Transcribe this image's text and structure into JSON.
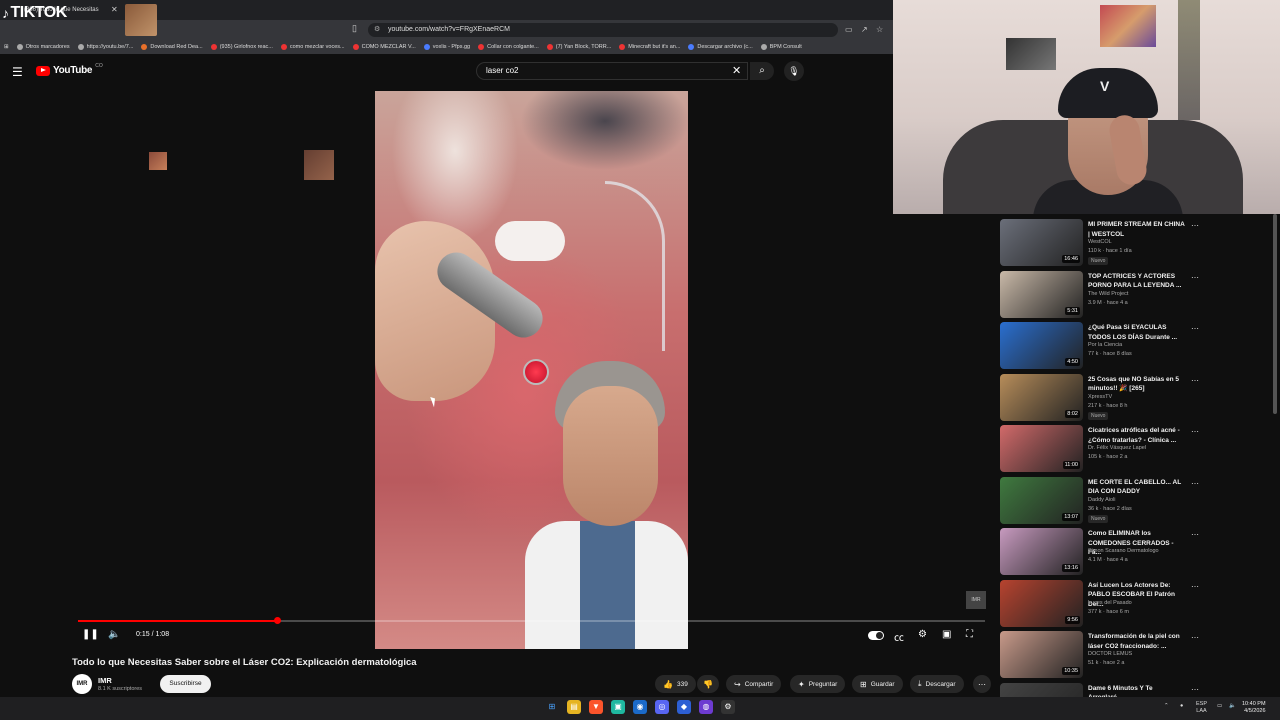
{
  "browser": {
    "tab_title": "(336) Todo lo que Necesitas",
    "url": "youtube.com/watch?v=FRgXEnaeRCM",
    "bookmarks": [
      {
        "label": "Otros marcadores",
        "color": "gray"
      },
      {
        "label": "https://youtu.be/7...",
        "color": "gray"
      },
      {
        "label": "Download Red Dea...",
        "color": "orange"
      },
      {
        "label": "(935) Girlofnox reac...",
        "color": "red"
      },
      {
        "label": "como mezclar voces...",
        "color": "red"
      },
      {
        "label": "COMO MEZCLAR V...",
        "color": "red"
      },
      {
        "label": "voxlis - Pfps.gg",
        "color": "blue"
      },
      {
        "label": "Collar con colgante...",
        "color": "red"
      },
      {
        "label": "(7) Yan Block, TORR...",
        "color": "red"
      },
      {
        "label": "Minecraft but it's an...",
        "color": "red"
      },
      {
        "label": "Descargar archivo (c...",
        "color": "blue"
      },
      {
        "label": "BPM Consult",
        "color": "gray"
      }
    ]
  },
  "overlay": {
    "tiktok_label": "TIKTOK"
  },
  "youtube": {
    "logo_text": "YouTube",
    "logo_region": "CO",
    "search_query": "laser co2"
  },
  "player": {
    "time_current": "0:15",
    "time_total": "1:08",
    "time_display": "0:15 / 1:08",
    "progress_fraction": 0.22,
    "channel_badge": "IMR"
  },
  "video": {
    "title": "Todo lo que Necesitas Saber sobre el Láser CO2: Explicación dermatológica",
    "channel_avatar": "IMR",
    "channel_name": "IMR",
    "subscribers": "8.1 K suscriptores",
    "subscribe_label": "Suscribirse",
    "likes": "339",
    "share_label": "Compartir",
    "ask_label": "Preguntar",
    "save_label": "Guardar",
    "download_label": "Descargar"
  },
  "recommendations": [
    {
      "title": "MI PRIMER STREAM EN CHINA | WESTCOL",
      "channel": "WestCOL",
      "meta": "110 k · hace 1 día",
      "duration": "16:46",
      "badge": "Nuevo",
      "thumb_color": "#6b6f7a"
    },
    {
      "title": "TOP ACTRICES Y ACTORES PORNO PARA LA LEYENDA ...",
      "channel": "The Wild Project",
      "meta": "3.9 M · hace 4 a",
      "duration": "5:31",
      "badge": "",
      "thumb_color": "#c9b9a8"
    },
    {
      "title": "¿Qué Pasa Si EYACULAS TODOS LOS DÍAS Durante ...",
      "channel": "Por la Ciencia",
      "meta": "77 k · hace 8 días",
      "duration": "4:50",
      "badge": "",
      "thumb_color": "#2a6fd0"
    },
    {
      "title": "25 Cosas que NO Sabías en 5 minutos!! 🎉 [265]",
      "channel": "XpressTV",
      "meta": "217 k · hace 8 h",
      "duration": "8:02",
      "badge": "Nuevo",
      "thumb_color": "#b78d5a"
    },
    {
      "title": "Cicatrices atróficas del acné - ¿Cómo tratarlas? - Clínica ...",
      "channel": "Dr. Félix Vásquez Lapel",
      "meta": "105 k · hace 2 a",
      "duration": "11:00",
      "badge": "",
      "thumb_color": "#d26a6a"
    },
    {
      "title": "ME CORTE EL CABELLO... AL DIA CON DADDY",
      "channel": "Daddy Aioli",
      "meta": "36 k · hace 2 días",
      "duration": "13:07",
      "badge": "Nuevo",
      "thumb_color": "#3f7a3f"
    },
    {
      "title": "Como ELIMINAR los COMEDONES CERRADOS - Fá...",
      "channel": "Simon Scarano Dermatologo",
      "meta": "4.1 M · hace 4 a",
      "duration": "13:16",
      "badge": "",
      "thumb_color": "#c79abf"
    },
    {
      "title": "Así Lucen Los Actores De: PABLO ESCOBAR El Patrón Del...",
      "channel": "Luces del Pasado",
      "meta": "377 k · hace 6 m",
      "duration": "9:56",
      "badge": "",
      "thumb_color": "#b7432f"
    },
    {
      "title": "Transformación de la piel con láser CO2 fraccionado: ...",
      "channel": "DOCTOR LEMUS",
      "meta": "51 k · hace 2 a",
      "duration": "10:35",
      "badge": "",
      "thumb_color": "#c89a8a"
    },
    {
      "title": "Dame 6 Minutos Y Te Arreglaré...",
      "channel": "",
      "meta": "",
      "duration": "",
      "badge": "",
      "thumb_color": "#444"
    }
  ],
  "taskbar": {
    "lang_top": "ESP",
    "lang_bottom": "LAA",
    "time": "10:40 PM",
    "date": "4/5/2026"
  }
}
